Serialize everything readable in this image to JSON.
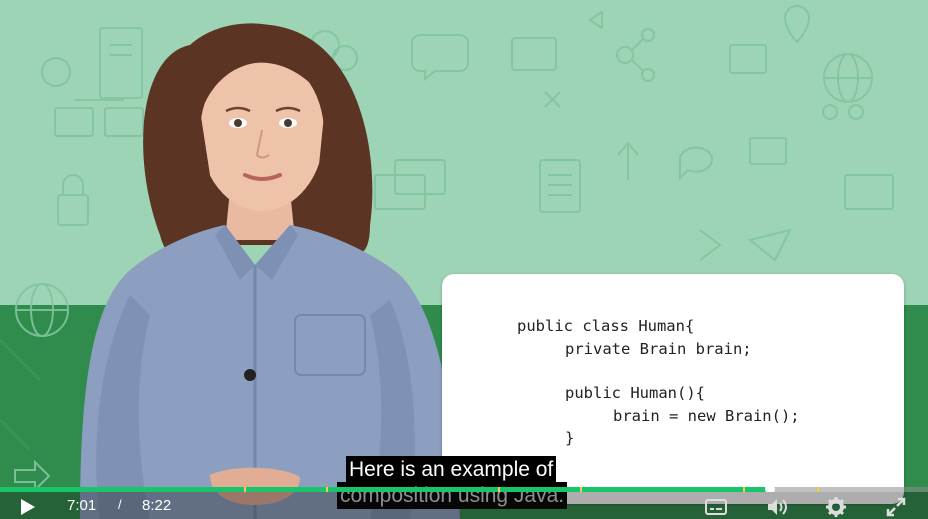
{
  "code_card": {
    "lines": [
      "public class Human{",
      "private Brain brain;",
      "public Human(){",
      "brain = new Brain();",
      "}"
    ]
  },
  "captions": {
    "line1": "Here is an example of",
    "line2": "composition using Java."
  },
  "player": {
    "current_time": "7:01",
    "separator": "/",
    "duration": "8:22",
    "progress_fraction": 0.839,
    "played_color": "#19c46b",
    "marker_color": "#f0d23c"
  },
  "controls": {
    "play_icon": "play-icon",
    "captions_icon": "captions-icon",
    "volume_icon": "volume-icon",
    "settings_icon": "gear-icon",
    "fullscreen_icon": "fullscreen-icon"
  },
  "colors": {
    "background_top": "#9cd4b5",
    "background_bottom": "#2f8c4c"
  }
}
